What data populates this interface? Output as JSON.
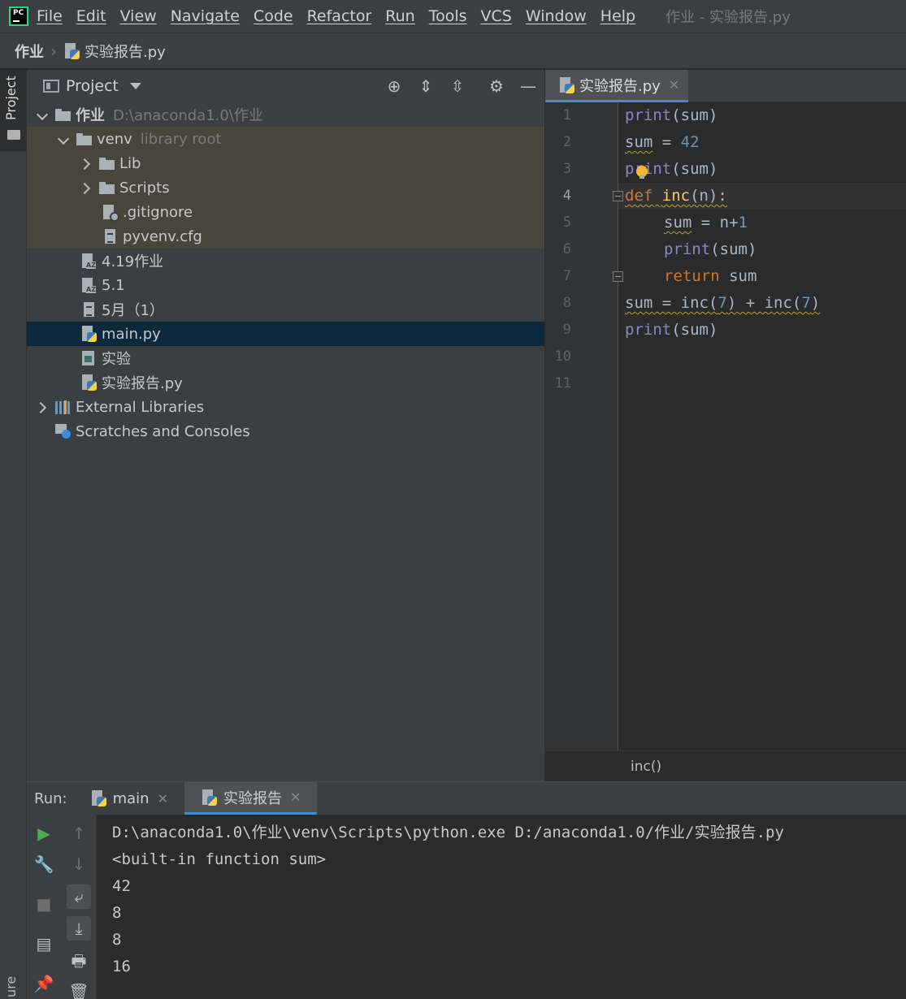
{
  "menubar": {
    "items": [
      "File",
      "Edit",
      "View",
      "Navigate",
      "Code",
      "Refactor",
      "Run",
      "Tools",
      "VCS",
      "Window",
      "Help"
    ],
    "title": "作业 - 实验报告.py",
    "logo": "PC"
  },
  "breadcrumb": {
    "root": "作业",
    "file": "实验报告.py"
  },
  "left_stripe": {
    "project": "Project",
    "structure": "ure"
  },
  "project_panel": {
    "title": "Project",
    "tree": [
      {
        "label": "作业",
        "hint": "D:\\anaconda1.0\\作业"
      },
      {
        "label": "venv",
        "hint": "library root"
      },
      {
        "label": "Lib"
      },
      {
        "label": "Scripts"
      },
      {
        "label": ".gitignore"
      },
      {
        "label": "pyvenv.cfg"
      },
      {
        "label": "4.19作业"
      },
      {
        "label": "5.1"
      },
      {
        "label": "5月（1）"
      },
      {
        "label": "main.py"
      },
      {
        "label": "实验"
      },
      {
        "label": "实验报告.py"
      },
      {
        "label": "External Libraries"
      },
      {
        "label": "Scratches and Consoles"
      }
    ]
  },
  "editor": {
    "tab": "实验报告.py",
    "line_numbers": [
      "1",
      "2",
      "3",
      "4",
      "5",
      "6",
      "7",
      "8",
      "9",
      "10",
      "11"
    ],
    "code": {
      "l1_fn": "print",
      "l1_rest": "(sum)",
      "l2_var": "sum",
      "l2_op": " = ",
      "l2_num": "42",
      "l3_fn": "print",
      "l3_rest": "(sum)",
      "l4_kw": "def",
      "l4_name": "inc",
      "l4_rest": "(n):",
      "l5_var": "sum",
      "l5_op": " = n+",
      "l5_num": "1",
      "l6_fn": "print",
      "l6_rest": "(sum)",
      "l7_kw": "return",
      "l7_rest": " sum",
      "l8_var": "sum",
      "l8_a": " = inc(",
      "l8_n1": "7",
      "l8_b": ") + inc(",
      "l8_n2": "7",
      "l8_c": ")",
      "l9_fn": "print",
      "l9_rest": "(sum)"
    },
    "context": "inc()"
  },
  "run_panel": {
    "label": "Run:",
    "tabs": [
      {
        "label": "main"
      },
      {
        "label": "实验报告"
      }
    ],
    "output": [
      "D:\\anaconda1.0\\作业\\venv\\Scripts\\python.exe D:/anaconda1.0/作业/实验报告.py",
      "<built-in function sum>",
      "42",
      "8",
      "8",
      "16"
    ]
  },
  "colors": {
    "keyword": "#cc7832",
    "builtin": "#8888c6",
    "number": "#6897bb",
    "function_def": "#ffc66d",
    "selection": "#0d293e",
    "run_icon": "#4caf50"
  },
  "icons": [
    "pycharm-logo-icon",
    "folder-icon",
    "python-file-icon",
    "text-file-icon",
    "locate-icon",
    "expand-all-icon",
    "collapse-all-icon",
    "gear-icon",
    "minimize-icon",
    "run-icon",
    "wrench-icon",
    "stop-icon",
    "layout-icon",
    "pin-icon",
    "up-arrow-icon",
    "down-arrow-icon",
    "soft-wrap-icon",
    "scroll-to-end-icon",
    "print-icon",
    "trash-icon",
    "lightbulb-icon"
  ]
}
